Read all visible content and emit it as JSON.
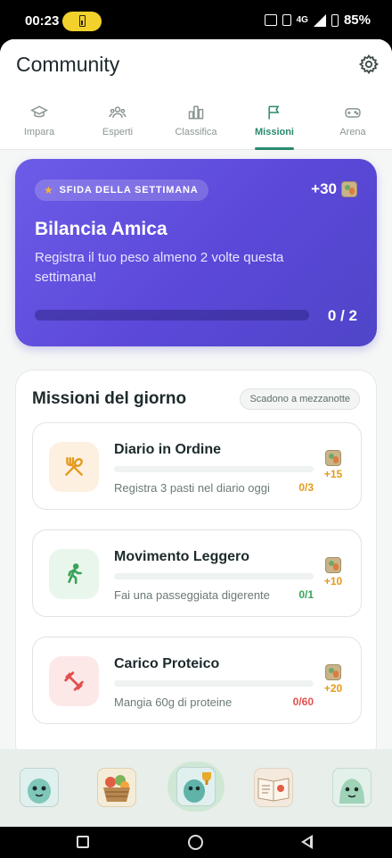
{
  "status_bar": {
    "time": "00:23",
    "network": "4G",
    "battery_percent": "85%"
  },
  "header": {
    "title": "Community",
    "settings_icon": "gear-icon"
  },
  "tabs": [
    {
      "label": "Impara",
      "icon": "graduation-cap-icon",
      "active": false
    },
    {
      "label": "Esperti",
      "icon": "people-icon",
      "active": false
    },
    {
      "label": "Classifica",
      "icon": "bar-chart-icon",
      "active": false
    },
    {
      "label": "Missioni",
      "icon": "flag-icon",
      "active": true
    },
    {
      "label": "Arena",
      "icon": "gamepad-icon",
      "active": false
    }
  ],
  "weekly_challenge": {
    "badge": "SFIDA DELLA SETTIMANA",
    "reward": "+30",
    "title": "Bilancia Amica",
    "description": "Registra il tuo peso almeno 2 volte questa settimana!",
    "progress": 0,
    "progress_label": "0 / 2",
    "colors": {
      "start": "#6c5ce7",
      "end": "#4f46c8"
    }
  },
  "daily_missions": {
    "title": "Missioni del giorno",
    "expiry": "Scadono a mezzanotte",
    "items": [
      {
        "title": "Diario in Ordine",
        "description": "Registra 3 pasti nel diario oggi",
        "count": "0/3",
        "reward": "+15",
        "progress": 0,
        "icon": "fork-spoon-icon",
        "accent": "#e59a1c",
        "icon_bg": "#fdf0e1"
      },
      {
        "title": "Movimento Leggero",
        "description": "Fai una passeggiata digerente",
        "count": "0/1",
        "reward": "+10",
        "progress": 0,
        "icon": "walking-person-icon",
        "accent": "#3aa35a",
        "icon_bg": "#e9f6ec"
      },
      {
        "title": "Carico Proteico",
        "description": "Mangia 60g di proteine",
        "count": "0/60",
        "reward": "+20",
        "progress": 0,
        "icon": "dumbbell-icon",
        "accent": "#e2504d",
        "icon_bg": "#fde8e8"
      }
    ]
  },
  "bottom_nav": [
    {
      "name": "mascot-home",
      "active": false
    },
    {
      "name": "food-basket",
      "active": false
    },
    {
      "name": "mascot-trophy",
      "active": true
    },
    {
      "name": "recipe-book",
      "active": false
    },
    {
      "name": "mascot-profile",
      "active": false
    }
  ]
}
